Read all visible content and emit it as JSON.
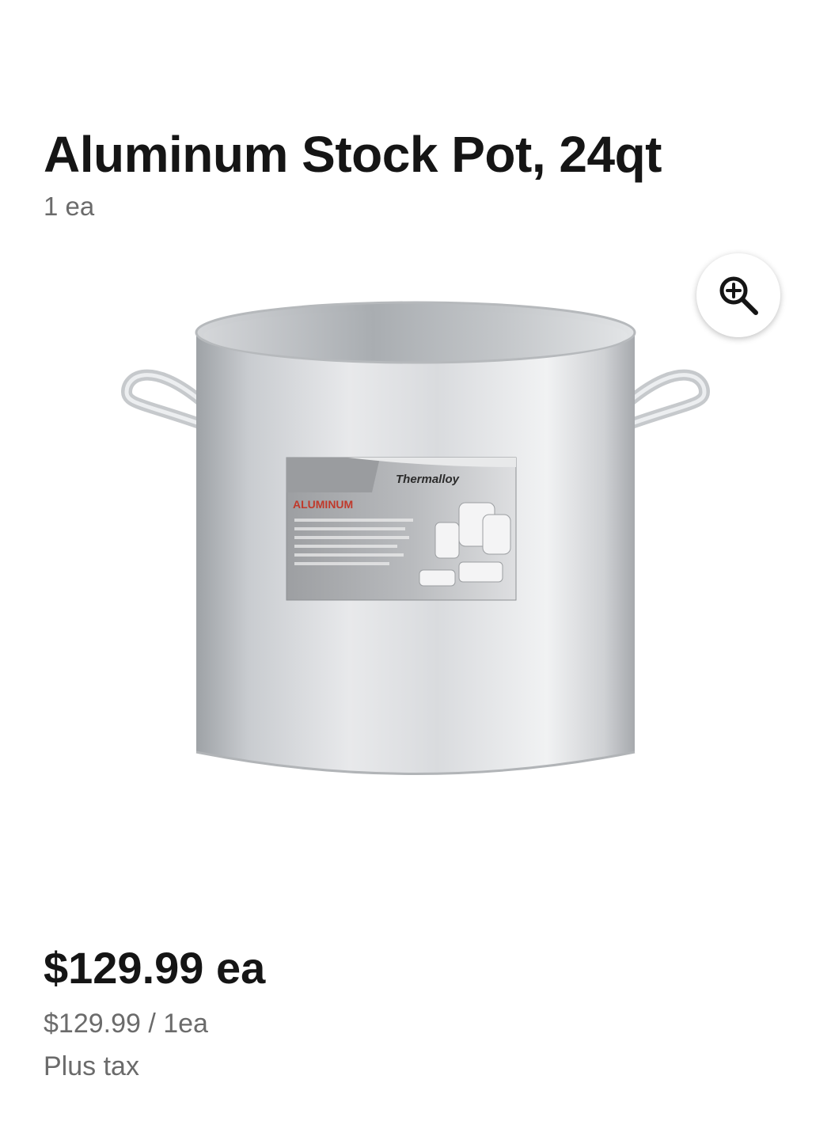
{
  "product": {
    "title": "Aluminum Stock Pot, 24qt",
    "size": "1 ea",
    "image_alt": "Aluminum stock pot",
    "label_brand": "Thermalloy",
    "label_material": "ALUMINUM"
  },
  "zoom": {
    "icon": "zoom-in-icon"
  },
  "pricing": {
    "price": "$129.99 ea",
    "unit_price": "$129.99 / 1ea",
    "tax_note": "Plus tax"
  }
}
